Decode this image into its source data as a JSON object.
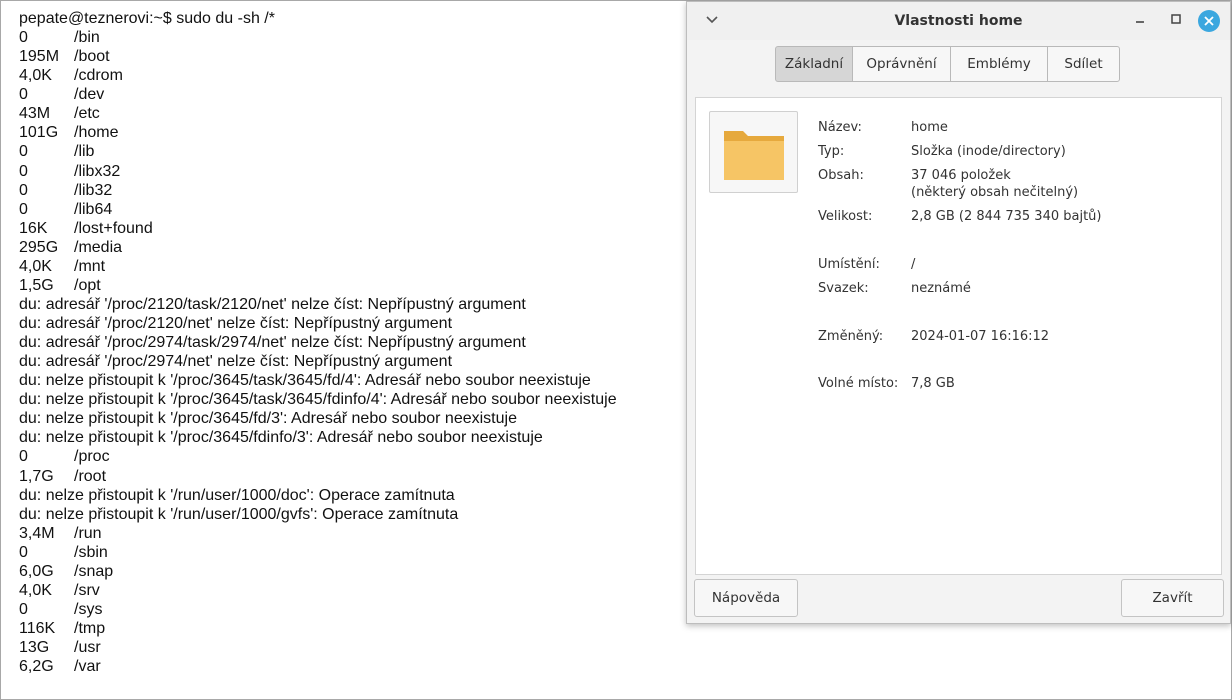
{
  "terminal": {
    "prompt": "pepate@teznerovi:~$ sudo du -sh /*",
    "lines": [
      {
        "size": "0",
        "path": "/bin"
      },
      {
        "size": "195M",
        "path": "/boot"
      },
      {
        "size": "4,0K",
        "path": "/cdrom"
      },
      {
        "size": "0",
        "path": "/dev"
      },
      {
        "size": "43M",
        "path": "/etc"
      },
      {
        "size": "101G",
        "path": "/home"
      },
      {
        "size": "0",
        "path": "/lib"
      },
      {
        "size": "0",
        "path": "/libx32"
      },
      {
        "size": "0",
        "path": "/lib32"
      },
      {
        "size": "0",
        "path": "/lib64"
      },
      {
        "size": "16K",
        "path": "/lost+found"
      },
      {
        "size": "295G",
        "path": "/media"
      },
      {
        "size": "4,0K",
        "path": "/mnt"
      },
      {
        "size": "1,5G",
        "path": "/opt"
      },
      {
        "text": "du: adresář '/proc/2120/task/2120/net' nelze číst: Nepřípustný argument"
      },
      {
        "text": "du: adresář '/proc/2120/net' nelze číst: Nepřípustný argument"
      },
      {
        "text": "du: adresář '/proc/2974/task/2974/net' nelze číst: Nepřípustný argument"
      },
      {
        "text": "du: adresář '/proc/2974/net' nelze číst: Nepřípustný argument"
      },
      {
        "text": "du: nelze přistoupit k '/proc/3645/task/3645/fd/4': Adresář nebo soubor neexistuje"
      },
      {
        "text": "du: nelze přistoupit k '/proc/3645/task/3645/fdinfo/4': Adresář nebo soubor neexistuje"
      },
      {
        "text": "du: nelze přistoupit k '/proc/3645/fd/3': Adresář nebo soubor neexistuje"
      },
      {
        "text": "du: nelze přistoupit k '/proc/3645/fdinfo/3': Adresář nebo soubor neexistuje"
      },
      {
        "size": "0",
        "path": "/proc"
      },
      {
        "size": "1,7G",
        "path": "/root"
      },
      {
        "text": "du: nelze přistoupit k '/run/user/1000/doc': Operace zamítnuta"
      },
      {
        "text": "du: nelze přistoupit k '/run/user/1000/gvfs': Operace zamítnuta"
      },
      {
        "size": "3,4M",
        "path": "/run"
      },
      {
        "size": "0",
        "path": "/sbin"
      },
      {
        "size": "6,0G",
        "path": "/snap"
      },
      {
        "size": "4,0K",
        "path": "/srv"
      },
      {
        "size": "0",
        "path": "/sys"
      },
      {
        "size": "116K",
        "path": "/tmp"
      },
      {
        "size": "13G",
        "path": "/usr"
      },
      {
        "size": "6,2G",
        "path": "/var"
      }
    ]
  },
  "dialog": {
    "title": "Vlastnosti home",
    "tabs": [
      {
        "label": "Základní",
        "active": true
      },
      {
        "label": "Oprávnění",
        "active": false
      },
      {
        "label": "Emblémy",
        "active": false
      },
      {
        "label": "Sdílet",
        "active": false
      }
    ],
    "icon": "folder-icon",
    "fields": {
      "name_label": "Název:",
      "name_value": "home",
      "type_label": "Typ:",
      "type_value": "Složka (inode/directory)",
      "contents_label": "Obsah:",
      "contents_value": "37 046 položek",
      "contents_note": "(některý obsah nečitelný)",
      "size_label": "Velikost:",
      "size_value": "2,8 GB (2 844 735 340 bajtů)",
      "location_label": "Umístění:",
      "location_value": "/",
      "volume_label": "Svazek:",
      "volume_value": "neznámé",
      "modified_label": "Změněný:",
      "modified_value": "2024-01-07 16:16:12",
      "free_label": "Volné místo:",
      "free_value": "7,8 GB"
    },
    "buttons": {
      "help": "Nápověda",
      "close": "Zavřít"
    },
    "colors": {
      "accent": "#3ba7df",
      "folder": "#f6c565",
      "folder_dark": "#e6a93d"
    }
  }
}
